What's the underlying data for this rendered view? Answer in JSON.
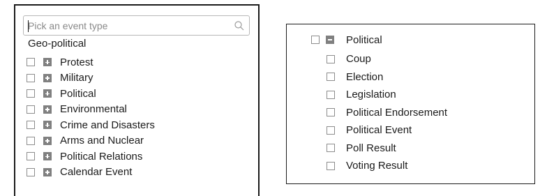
{
  "search": {
    "placeholder": "Pick an event type",
    "value": ""
  },
  "left_panel": {
    "group_title": "Geo-political",
    "items": [
      {
        "label": "Protest",
        "checked": false,
        "expanded": false
      },
      {
        "label": "Military",
        "checked": false,
        "expanded": false
      },
      {
        "label": "Political",
        "checked": false,
        "expanded": false
      },
      {
        "label": "Environmental",
        "checked": false,
        "expanded": false
      },
      {
        "label": "Crime and Disasters",
        "checked": false,
        "expanded": false
      },
      {
        "label": "Arms and Nuclear",
        "checked": false,
        "expanded": false
      },
      {
        "label": "Political Relations",
        "checked": false,
        "expanded": false
      },
      {
        "label": "Calendar Event",
        "checked": false,
        "expanded": false
      }
    ]
  },
  "right_panel": {
    "parent_label": "Political",
    "parent_checked": false,
    "parent_expanded": true,
    "children": [
      {
        "label": "Coup",
        "checked": false
      },
      {
        "label": "Election",
        "checked": false
      },
      {
        "label": "Legislation",
        "checked": false
      },
      {
        "label": "Political Endorsement",
        "checked": false
      },
      {
        "label": "Political Event",
        "checked": false
      },
      {
        "label": "Poll Result",
        "checked": false
      },
      {
        "label": "Voting Result",
        "checked": false
      }
    ]
  },
  "colors": {
    "border": "#1a1a1a",
    "checkbox_border": "#8c8c8c",
    "expander_fill": "#808080",
    "placeholder_text": "#8a8a8a",
    "search_border": "#b7b7b7"
  },
  "icons": {
    "search": "magnifier-icon",
    "expand": "plus-box-icon",
    "collapse": "minus-box-icon"
  }
}
